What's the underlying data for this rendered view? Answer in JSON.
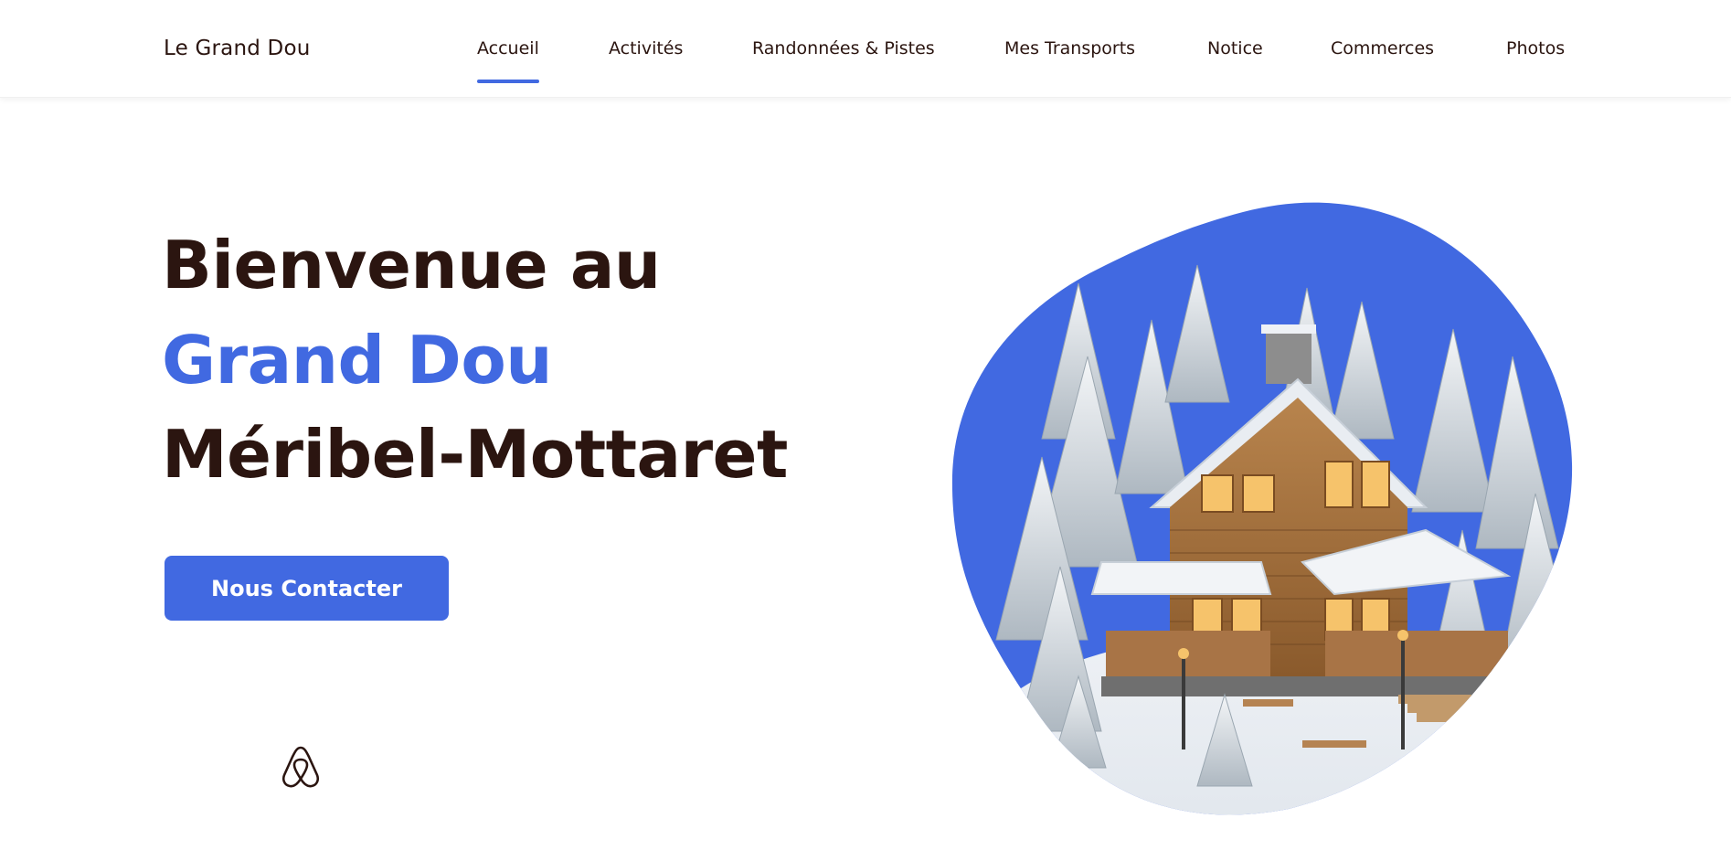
{
  "header": {
    "brand": "Le Grand Dou",
    "nav": [
      {
        "label": "Accueil",
        "active": true
      },
      {
        "label": "Activités",
        "active": false
      },
      {
        "label": "Randonnées & Pistes",
        "active": false
      },
      {
        "label": "Mes Transports",
        "active": false
      },
      {
        "label": "Notice",
        "active": false
      },
      {
        "label": "Commerces",
        "active": false
      },
      {
        "label": "Photos",
        "active": false
      }
    ]
  },
  "hero": {
    "line1": "Bienvenue au",
    "line2": "Grand Dou",
    "line3": "Méribel-Mottaret",
    "cta_label": "Nous Contacter",
    "icon": "airbnb-icon",
    "image_subject": "snow-covered-chalet"
  },
  "colors": {
    "accent": "#4169e1",
    "text": "#2b1510",
    "background": "#ffffff"
  }
}
